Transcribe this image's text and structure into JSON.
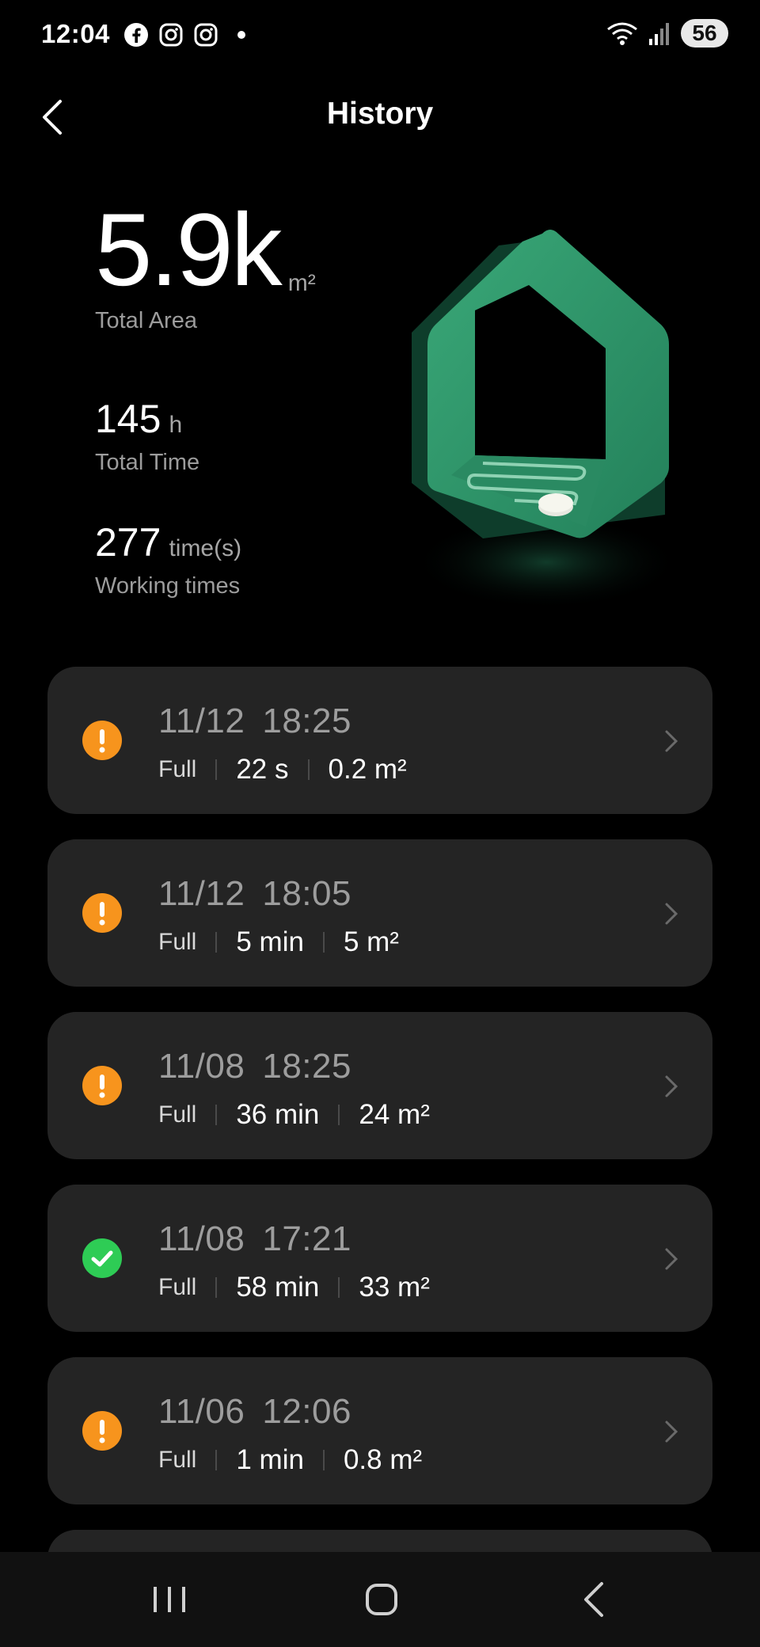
{
  "status_bar": {
    "time": "12:04",
    "left_icons": [
      "facebook-icon",
      "instagram-icon",
      "instagram-icon",
      "notification-dot"
    ],
    "right_icons": [
      "wifi-icon",
      "signal-icon"
    ],
    "battery": "56"
  },
  "header": {
    "title": "History"
  },
  "summary": {
    "area_value": "5.9k",
    "area_unit": "m²",
    "area_label": "Total Area",
    "time_value": "145",
    "time_unit": "h",
    "time_label": "Total Time",
    "count_value": "277",
    "count_unit": "time(s)",
    "count_label": "Working times"
  },
  "records": [
    {
      "date": "11/12",
      "time": "18:25",
      "mode": "Full",
      "duration": "22 s",
      "area": "0.2 m²",
      "status": "warning"
    },
    {
      "date": "11/12",
      "time": "18:05",
      "mode": "Full",
      "duration": "5 min",
      "area": "5 m²",
      "status": "warning"
    },
    {
      "date": "11/08",
      "time": "18:25",
      "mode": "Full",
      "duration": "36 min",
      "area": "24 m²",
      "status": "warning"
    },
    {
      "date": "11/08",
      "time": "17:21",
      "mode": "Full",
      "duration": "58 min",
      "area": "33 m²",
      "status": "success"
    },
    {
      "date": "11/06",
      "time": "12:06",
      "mode": "Full",
      "duration": "1 min",
      "area": "0.8 m²",
      "status": "warning"
    }
  ],
  "colors": {
    "warning": "#f7941d",
    "success": "#2ecc55",
    "card": "#242424",
    "accent_green": "#2f9a6a"
  },
  "navbar": {
    "icons": [
      "recent-apps-icon",
      "home-icon",
      "back-icon"
    ]
  }
}
